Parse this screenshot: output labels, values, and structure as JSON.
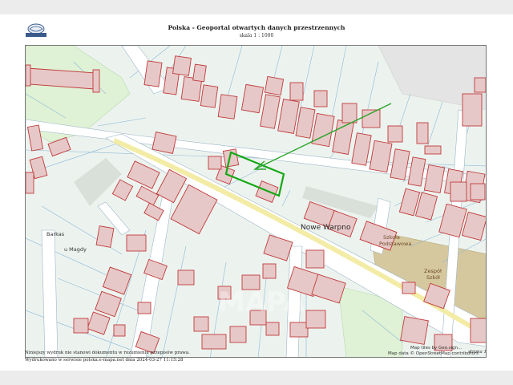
{
  "header": {
    "title": "Polska - Geoportal otwartych danych przestrzennych",
    "scale": "skala 1 : 1000",
    "logo_text": "GEO-SYSTEM"
  },
  "map": {
    "place_labels": {
      "town": "Nowe Warpno",
      "school_small": [
        "Szkoła",
        "Podstawowa"
      ],
      "school_complex": [
        "Zespół",
        "Szkół"
      ],
      "barkas": "Barkas",
      "magdy": "u Magdy"
    },
    "attribution": [
      "Map tiles by Geo.sign...",
      "Map data © OpenStreetMap contributors"
    ],
    "watermark": "MAPA",
    "colors": {
      "background": "#ecf3ef",
      "parcel_line": "#8fb8d4",
      "building_fill": "#e7c8c8",
      "building_stroke": "#c03a3a",
      "road_fill": "#ffffff",
      "main_road_stripe": "#f3eca6",
      "green_area": "#dff2d6",
      "school_area": "#d6c89e",
      "plot_highlight": "#15a815",
      "arrow": "#2aa52a"
    }
  },
  "footer": {
    "disclaimer": "Niniejszy wydruk nie stanowi dokumentu w rozumieniu przepisów prawa.",
    "generated": "Wydrukowano w serwisie polska.e-mapa.net dnia 2024-03-27 11:15:28",
    "page": "strona 1"
  }
}
